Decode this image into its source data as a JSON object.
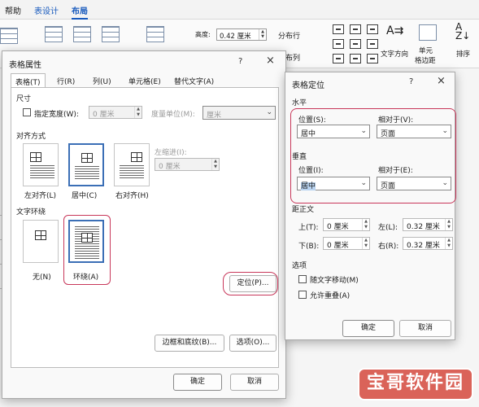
{
  "ribbon": {
    "tabs": [
      "帮助",
      "表设计",
      "布局"
    ],
    "active_tab": "布局",
    "height_label": "高度:",
    "height_value": "0.42 厘米",
    "distribute_rows": "分布行",
    "distribute_cols": "分布列",
    "text_direction": "文字方向",
    "cell_margin_1": "单元",
    "cell_margin_2": "格边距",
    "sort": "排序",
    "icons": [
      "table-icon",
      "gridlines-icon",
      "split-icon",
      "merge-icon",
      "autofit-icon"
    ]
  },
  "table_props": {
    "title": "表格属性",
    "help": "?",
    "close": "×",
    "tabs": [
      "表格(T)",
      "行(R)",
      "列(U)",
      "单元格(E)",
      "替代文字(A)"
    ],
    "size_section": "尺寸",
    "specify_width": "指定宽度(W):",
    "width_value": "0 厘米",
    "unit_label": "度量单位(M):",
    "unit_value": "厘米",
    "alignment_section": "对齐方式",
    "align_left": "左对齐(L)",
    "align_center": "居中(C)",
    "align_right": "右对齐(H)",
    "indent_label": "左缩进(I):",
    "indent_value": "0 厘米",
    "wrap_section": "文字环绕",
    "wrap_none": "无(N)",
    "wrap_around": "环绕(A)",
    "positioning_button": "定位(P)...",
    "borders_button": "边框和底纹(B)...",
    "options_button": "选项(O)...",
    "ok": "确定",
    "cancel": "取消"
  },
  "positioning": {
    "title": "表格定位",
    "help": "?",
    "close": "×",
    "horizontal_section": "水平",
    "h_position_label": "位置(S):",
    "h_position_value": "居中",
    "h_relative_label": "相对于(V):",
    "h_relative_value": "页面",
    "vertical_section": "垂直",
    "v_position_label": "位置(I):",
    "v_position_value": "居中",
    "v_relative_label": "相对于(E):",
    "v_relative_value": "页面",
    "distance_section": "距正文",
    "top_label": "上(T):",
    "top_value": "0 厘米",
    "bottom_label": "下(B):",
    "bottom_value": "0 厘米",
    "left_label": "左(L):",
    "left_value": "0.32 厘米",
    "right_label": "右(R):",
    "right_value": "0.32 厘米",
    "options_section": "选项",
    "move_with_text": "随文字移动(M)",
    "allow_overlap": "允许重叠(A)",
    "ok": "确定",
    "cancel": "取消"
  },
  "watermark": "宝哥软件园",
  "colors": {
    "accent": "#185abd",
    "highlight": "#c8375a"
  }
}
